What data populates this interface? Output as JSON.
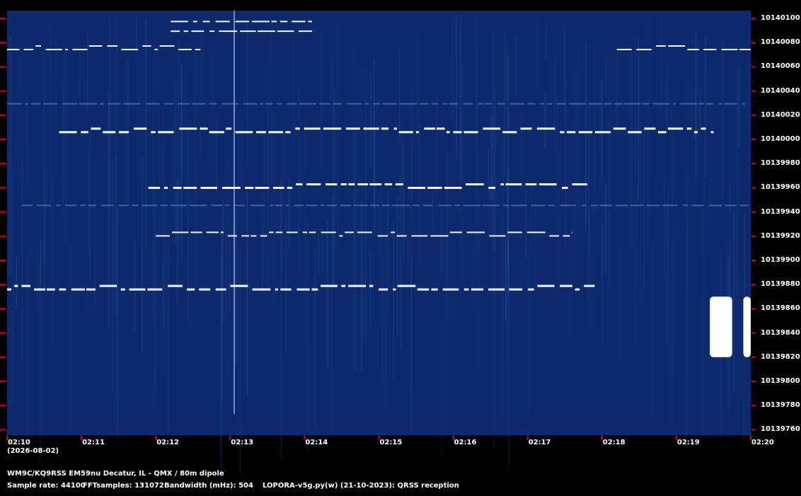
{
  "chart_data": {
    "type": "heatmap",
    "title": "WM9C/KQ9RSS EM59nu Decatur, IL - QMX / 80m dipole",
    "date": "(2026-08-02)",
    "x_ticks": [
      "02:10",
      "02:11",
      "02:12",
      "02:13",
      "02:14",
      "02:15",
      "02:16",
      "02:17",
      "02:18",
      "02:19",
      "02:20"
    ],
    "y_ticks": [
      10140100,
      10140080,
      10140060,
      10140040,
      10140020,
      10140000,
      10139980,
      10139960,
      10139940,
      10139920,
      10139900,
      10139880,
      10139860,
      10139840,
      10139820,
      10139800,
      10139780,
      10139760
    ],
    "ylim": [
      10139760,
      10140100
    ],
    "background_color": "#0d2a6e",
    "tick_color": "#e00000",
    "signals": [
      {
        "freq": 10140098,
        "t_start": 0.22,
        "t_end": 0.41,
        "style": "burst"
      },
      {
        "freq": 10140090,
        "t_start": 0.22,
        "t_end": 0.41,
        "style": "burst"
      },
      {
        "freq": 10140076,
        "t_start": 0.0,
        "t_end": 0.26,
        "style": "morse"
      },
      {
        "freq": 10140076,
        "t_start": 0.82,
        "t_end": 1.0,
        "style": "morse"
      },
      {
        "freq": 10140030,
        "t_start": 0.0,
        "t_end": 1.0,
        "style": "faint"
      },
      {
        "freq": 10140008,
        "t_start": 0.07,
        "t_end": 0.95,
        "style": "strong"
      },
      {
        "freq": 10139962,
        "t_start": 0.19,
        "t_end": 0.78,
        "style": "strong"
      },
      {
        "freq": 10139946,
        "t_start": 0.02,
        "t_end": 1.0,
        "style": "faint"
      },
      {
        "freq": 10139922,
        "t_start": 0.2,
        "t_end": 0.76,
        "style": "morse"
      },
      {
        "freq": 10139878,
        "t_start": 0.0,
        "t_end": 0.79,
        "style": "strong"
      },
      {
        "freq": 10139840,
        "t_start": 0.945,
        "t_end": 0.975,
        "style": "blob"
      },
      {
        "freq": 10139840,
        "t_start": 0.99,
        "t_end": 1.0,
        "style": "blob"
      }
    ]
  },
  "footer": {
    "station": "WM9C/KQ9RSS EM59nu Decatur, IL - QMX / 80m dipole",
    "sample_rate": "Sample rate: 44100",
    "fft_samples": "FFTsamples: 131072",
    "bandwidth": "Bandwidth (mHz): 504",
    "software": "LOPORA-v5g.py(w) (21-10-2023): QRSS reception"
  }
}
